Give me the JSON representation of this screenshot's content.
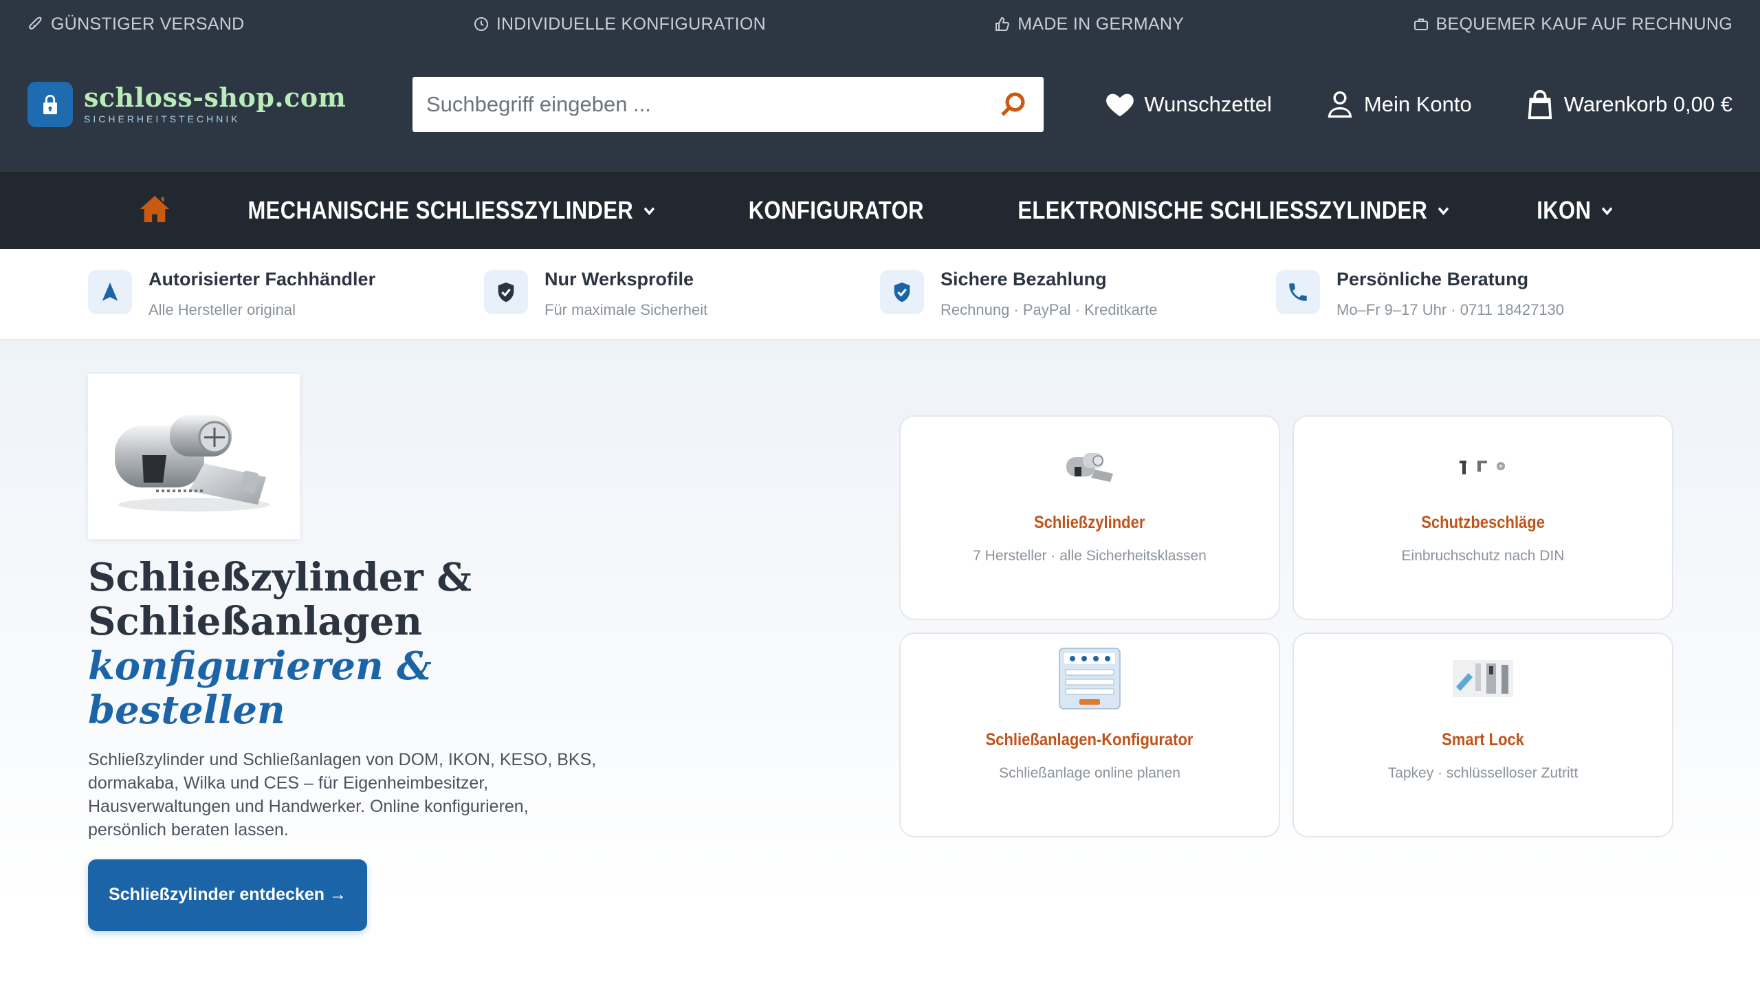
{
  "infobar": {
    "items": [
      {
        "label": "GÜNSTIGER VERSAND",
        "icon": "rocket-icon"
      },
      {
        "label": "INDIVIDUELLE KONFIGURATION",
        "icon": "clock-icon"
      },
      {
        "label": "MADE IN GERMANY",
        "icon": "thumbs-up-icon"
      },
      {
        "label": "BEQUEMER KAUF AUF RECHNUNG",
        "icon": "briefcase-icon"
      }
    ]
  },
  "header": {
    "logo_name": "schloss-shop.com",
    "logo_sub": "SICHERHEITSTECHNIK",
    "search_placeholder": "Suchbegriff eingeben ...",
    "wishlist_label": "Wunschzettel",
    "account_label": "Mein Konto",
    "cart_label": "Warenkorb 0,00 €"
  },
  "nav": {
    "items": [
      {
        "label": "MECHANISCHE SCHLIESSZYLINDER",
        "has_dropdown": true
      },
      {
        "label": "KONFIGURATOR",
        "has_dropdown": false
      },
      {
        "label": "ELEKTRONISCHE SCHLIESSZYLINDER",
        "has_dropdown": true
      },
      {
        "label": "IKON",
        "has_dropdown": true
      }
    ]
  },
  "trust": {
    "items": [
      {
        "title": "Autorisierter Fachhändler",
        "sub": "Alle Hersteller original",
        "icon": "navigation-arrow-icon"
      },
      {
        "title": "Nur Werksprofile",
        "sub": "Für maximale Sicherheit",
        "icon": "shield-check-icon"
      },
      {
        "title": "Sichere Bezahlung",
        "sub": "Rechnung · PayPal · Kreditkarte",
        "icon": "shield-check-icon"
      },
      {
        "title": "Persönliche Beratung",
        "sub": "Mo–Fr 9–17 Uhr · 0711 18427130",
        "icon": "phone-icon"
      }
    ]
  },
  "hero": {
    "title": "Schließzylinder & Schließanlagen",
    "title_accent": "konfigurieren & bestellen",
    "text": "Schließzylinder und Schließanlagen von DOM, IKON, KESO, BKS, dormakaba, Wilka und CES – für Eigenheimbesitzer, Hausverwaltungen und Handwerker. Online konfigurieren, persönlich beraten lassen.",
    "cta_label": "Schließzylinder entdecken →"
  },
  "cards": [
    {
      "title": "Schließzylinder",
      "sub": "7 Hersteller · alle Sicherheitsklassen"
    },
    {
      "title": "Schutzbeschläge",
      "sub": "Einbruchschutz nach DIN"
    },
    {
      "title": "Schließanlagen-Konfigurator",
      "sub": "Schließanlage online planen"
    },
    {
      "title": "Smart Lock",
      "sub": "Tapkey · schlüsselloser Zutritt"
    }
  ],
  "colors": {
    "header_bg": "#2d3743",
    "nav_bg": "#22282f",
    "accent_orange": "#c85a12",
    "brand_blue": "#1c64a8"
  }
}
